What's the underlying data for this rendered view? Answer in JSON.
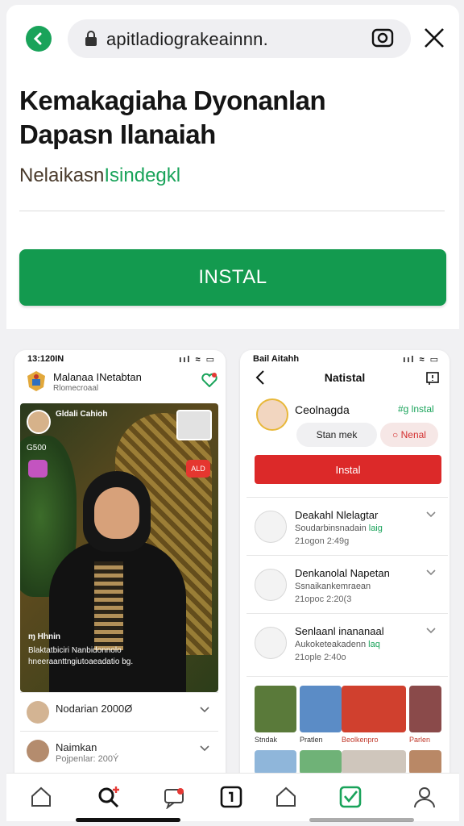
{
  "browser": {
    "url": "apitladiograkeainnn.",
    "colors": {
      "brand_green": "#19a35a",
      "install_red": "#dc2929"
    }
  },
  "hero": {
    "title_line1": "Kemakagiaha Dyonanlan",
    "title_line2": "Dapasn Ilanaiah",
    "subtitle_main": "Nelaikasn",
    "subtitle_accent": "Isindegkl",
    "install_label": "INSTAL"
  },
  "left_phone": {
    "status_time": "13:120IN",
    "status_icons": "ııl ≈ ▭",
    "title": "Malanaa INetabtan",
    "subtitle": "Rlomecroaal",
    "host_name": "Gldali Cahioh",
    "host_sub": "",
    "viewer_count": "G500",
    "red_badge": "ALD",
    "caption_handle": "ɱ Hhnin",
    "caption_text": "Blaktatbiciri Nanbidonnolo hneeraanttngiutoaeadatio bg.",
    "rows": [
      {
        "label": "Nodarian 2000Ø",
        "label2": ""
      },
      {
        "label": "Naimkan",
        "label2": "Pojpenlar: 200Ý"
      }
    ]
  },
  "right_phone": {
    "status_time": "Bail Aitahh",
    "status_icons": "ııl ≈ ▭",
    "title": "Natistal",
    "profile_name": "Ceolnagda",
    "profile_tag": "#g lnstal",
    "pill_gray": "Stan mek",
    "pill_red": "Nenal",
    "install_label": "Instal",
    "rows": [
      {
        "t1": "Deakahl Nlelagtar",
        "t2": "Soudarbinsnadain",
        "t2_accent": "laig",
        "t3": "21ogon 2:49g"
      },
      {
        "t1": "Denkanolal Napetan",
        "t2": "Ssnaikankemraean",
        "t2_accent": "",
        "t3": "21opoc 2:20(3"
      },
      {
        "t1": "Senlaanl inananaal",
        "t2": "Aukoketeakadenn",
        "t2_accent": "laq",
        "t3": "21ople 2:40o"
      }
    ],
    "thumbs": [
      "Stndak",
      "Pratlen",
      "Beolkenpro",
      "Parlen"
    ]
  },
  "nav": {
    "items": [
      "home-icon",
      "search-add-icon",
      "chat-notify-icon",
      "live-icon",
      "home-outline-icon",
      "install-check-icon",
      "profile-icon"
    ]
  }
}
